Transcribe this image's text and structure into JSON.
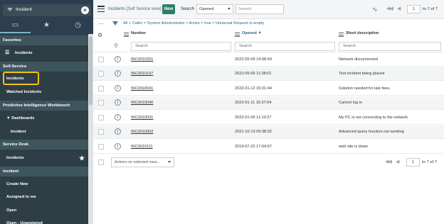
{
  "sidebar": {
    "search_value": "Incident",
    "sections": {
      "favorites": "Favorites",
      "self_service": "Self-Service",
      "pi_workbench": "Predictive Intelligence Workbench",
      "service_desk": "Service Desk",
      "incident": "Incident"
    },
    "items": {
      "fav_incidents": "Incidents",
      "ss_incidents": "Incidents",
      "watched": "Watched Incidents",
      "dashboards": "▼ Dashboards",
      "dash_incident": "Incident",
      "sd_incidents": "Incidents",
      "create_new": "Create New",
      "assigned": "Assigned to me",
      "open": "Open",
      "open_unassigned": "Open - Unassigned"
    }
  },
  "header": {
    "title_main": "Incidents",
    "title_view": "[Self Service view]",
    "new_label": "New",
    "search_label": "Search",
    "field_selected": "Opened",
    "search_placeholder": "Search",
    "page_value": "1",
    "page_of": "to 7 of 7"
  },
  "breadcrumb": "All > Caller = System Administrator > Active = true > Universal Request is empty",
  "columns": {
    "number": "Number",
    "opened": "Opened ▼",
    "short_description": "Short description"
  },
  "column_search_placeholder": "Search",
  "rows": [
    {
      "number": "INC0010201",
      "opened": "2022-05-09 14:08:43",
      "desc": "Network disconnected"
    },
    {
      "number": "INC0010197",
      "opened": "2022-05-05 11:38:01",
      "desc": "Test incident being placed"
    },
    {
      "number": "INC0010041",
      "opened": "2022-01-12 15:01:44",
      "desc": "Solution needed for late fees."
    },
    {
      "number": "INC0010040",
      "opened": "2022-01-11 16:37:04",
      "desc": "Cannot log in"
    },
    {
      "number": "INC0010031",
      "opened": "2022-01-05 11:10:27",
      "desc": "My PC is not connecting to the network"
    },
    {
      "number": "INC0010002",
      "opened": "2021-10-13 09:38:02",
      "desc": "Advanced query function not working"
    },
    {
      "number": "INC0010111",
      "opened": "2019-07-22 17:04:57",
      "desc": "web site is down"
    }
  ],
  "footer": {
    "actions_label": "Actions on selected rows...",
    "page_value": "1",
    "page_of": "to 7 of 7"
  },
  "colors": {
    "sidebar_bg": "#2e3e45",
    "new_button": "#2e7d6b",
    "link": "#2a6a8a",
    "highlight_border": "#f0c419"
  }
}
